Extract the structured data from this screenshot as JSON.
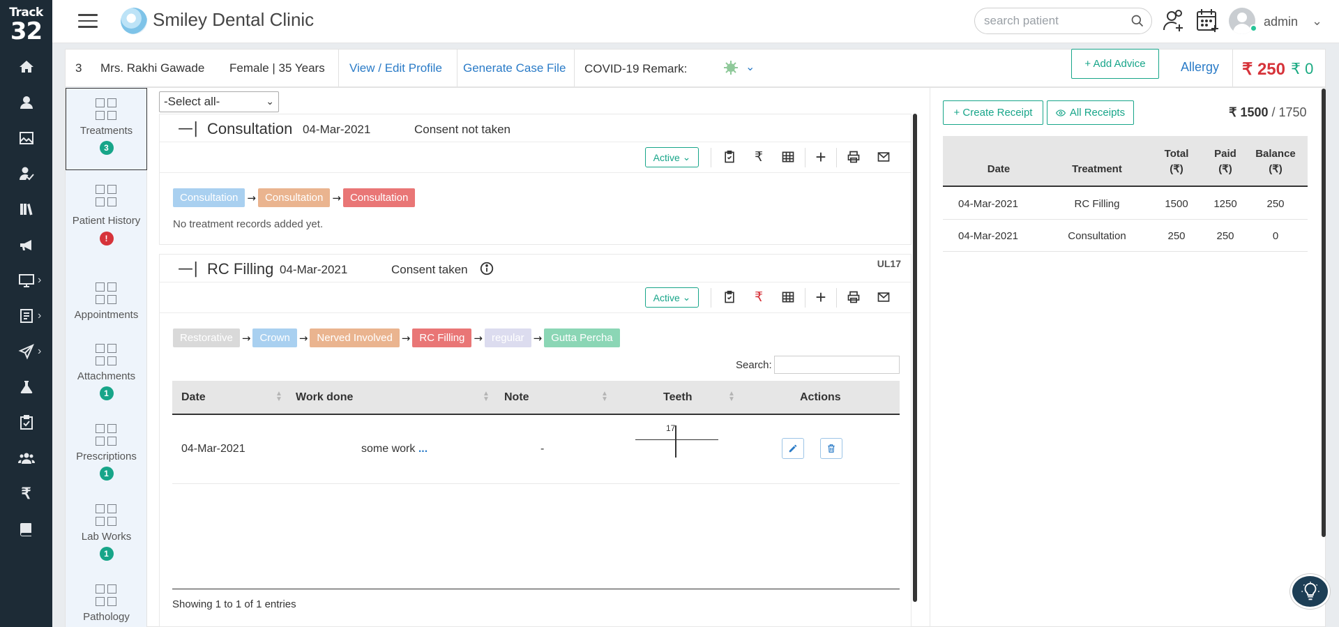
{
  "brand": {
    "line1": "Track",
    "line2": "32"
  },
  "header": {
    "clinic_name": "Smiley Dental Clinic",
    "search_placeholder": "search patient",
    "user": "admin"
  },
  "patient": {
    "id": "3",
    "name": "Mrs. Rakhi Gawade",
    "gender_age": "Female | 35 Years",
    "view_edit_link": "View / Edit Profile",
    "case_file_link": "Generate Case File",
    "covid_label": "COVID-19 Remark:",
    "add_advice": "+ Add Advice",
    "allergy": "Allergy",
    "due_amount": "₹ 250",
    "credit_amount": "₹ 0"
  },
  "categories": [
    {
      "label": "Treatments",
      "badge": "3"
    },
    {
      "label": "Patient History",
      "badge": "!"
    },
    {
      "label": "Appointments",
      "badge": ""
    },
    {
      "label": "Attachments",
      "badge": "1"
    },
    {
      "label": "Prescriptions",
      "badge": "1"
    },
    {
      "label": "Lab Works",
      "badge": "1"
    },
    {
      "label": "Pathology",
      "badge": ""
    }
  ],
  "select_all": "-Select all-",
  "treatments": [
    {
      "name": "Consultation",
      "date": "04-Mar-2021",
      "consent": "Consent not taken",
      "status": "Active",
      "pills": [
        {
          "label": "Consultation",
          "color": "#a9d0f0"
        },
        {
          "label": "Consultation",
          "color": "#eab48f"
        },
        {
          "label": "Consultation",
          "color": "#e97676"
        }
      ],
      "empty_text": "No treatment records added yet."
    },
    {
      "name": "RC Filling",
      "date": "04-Mar-2021",
      "consent": "Consent taken",
      "tooth_code": "UL17",
      "status": "Active",
      "pills": [
        {
          "label": "Restorative",
          "color": "#d9d9d9"
        },
        {
          "label": "Crown",
          "color": "#a9d0f0"
        },
        {
          "label": "Nerved Involved",
          "color": "#eab48f"
        },
        {
          "label": "RC Filling",
          "color": "#e97676"
        },
        {
          "label": "regular",
          "color": "#dcdcef"
        },
        {
          "label": "Gutta Percha",
          "color": "#8bd6b5"
        }
      ],
      "table": {
        "search_label": "Search:",
        "columns": [
          "Date",
          "Work done",
          "Note",
          "Teeth",
          "Actions"
        ],
        "rows": [
          {
            "date": "04-Mar-2021",
            "work": "some work",
            "more": "...",
            "note": "-",
            "tooth": "17"
          }
        ],
        "info": "Showing 1 to 1 of 1 entries"
      }
    }
  ],
  "receipts": {
    "create_label": "+ Create Receipt",
    "all_label": "All Receipts",
    "paid_total": "₹ 1500",
    "grand_total": "/ 1750",
    "columns": {
      "date": "Date",
      "treatment": "Treatment",
      "total": "Total",
      "paid": "Paid",
      "balance": "Balance",
      "currency": "(₹)"
    },
    "rows": [
      {
        "date": "04-Mar-2021",
        "treatment": "RC Filling",
        "total": "1500",
        "paid": "1250",
        "balance": "250"
      },
      {
        "date": "04-Mar-2021",
        "treatment": "Consultation",
        "total": "250",
        "paid": "250",
        "balance": "0"
      }
    ]
  },
  "colors": {
    "accent": "#17a589",
    "link": "#2a7bc7",
    "danger": "#d6333a",
    "nav_bg": "#1d2b36"
  }
}
